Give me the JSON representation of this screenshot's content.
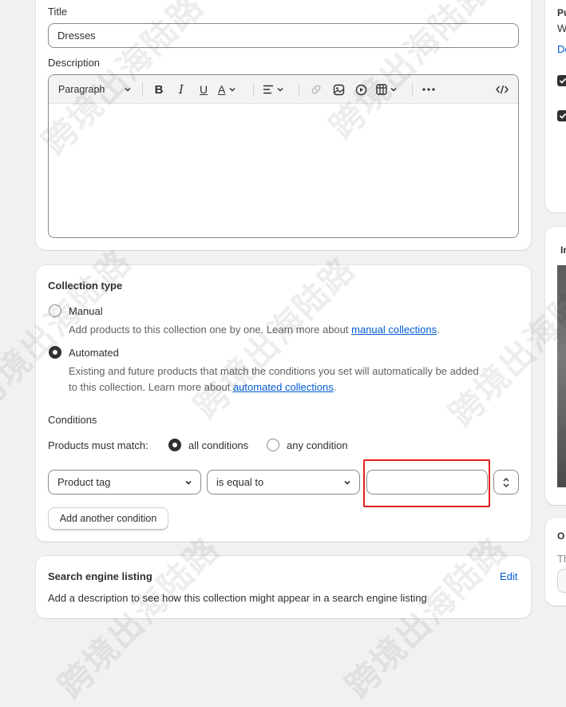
{
  "title_field": {
    "label": "Title",
    "value": "Dresses"
  },
  "description": {
    "label": "Description",
    "toolbar": {
      "paragraph_label": "Paragraph"
    }
  },
  "collection_type": {
    "heading": "Collection type",
    "manual": {
      "label": "Manual",
      "help_prefix": "Add products to this collection one by one. Learn more about ",
      "help_link": "manual collections",
      "help_suffix": "."
    },
    "automated": {
      "label": "Automated",
      "help_line1": "Existing and future products that match the conditions you set will automatically be added",
      "help_prefix": "to this collection. Learn more about ",
      "help_link": "automated collections",
      "help_suffix": "."
    },
    "selected": "automated"
  },
  "conditions": {
    "heading": "Conditions",
    "match_label": "Products must match:",
    "all_label": "all conditions",
    "any_label": "any condition",
    "selected_match": "all",
    "field_value": "Product tag",
    "operator_value": "is equal to",
    "value_input": "",
    "add_button": "Add another condition"
  },
  "seo": {
    "heading": "Search engine listing",
    "edit_link": "Edit",
    "help": "Add a description to see how this collection might appear in a search engine listing"
  },
  "right_column": {
    "publishing_heading_clip": "Pu",
    "publishing_sub_clip": "W",
    "publishing_link_clip": "De",
    "image_heading_clip": "Im",
    "other_heading_clip": "O",
    "other_sub_clip": "Th"
  },
  "watermark_text": "跨境出海陆路",
  "colors": {
    "link": "#005bd3",
    "highlight": "#e41e1e",
    "text": "#303030",
    "muted": "#616161"
  }
}
